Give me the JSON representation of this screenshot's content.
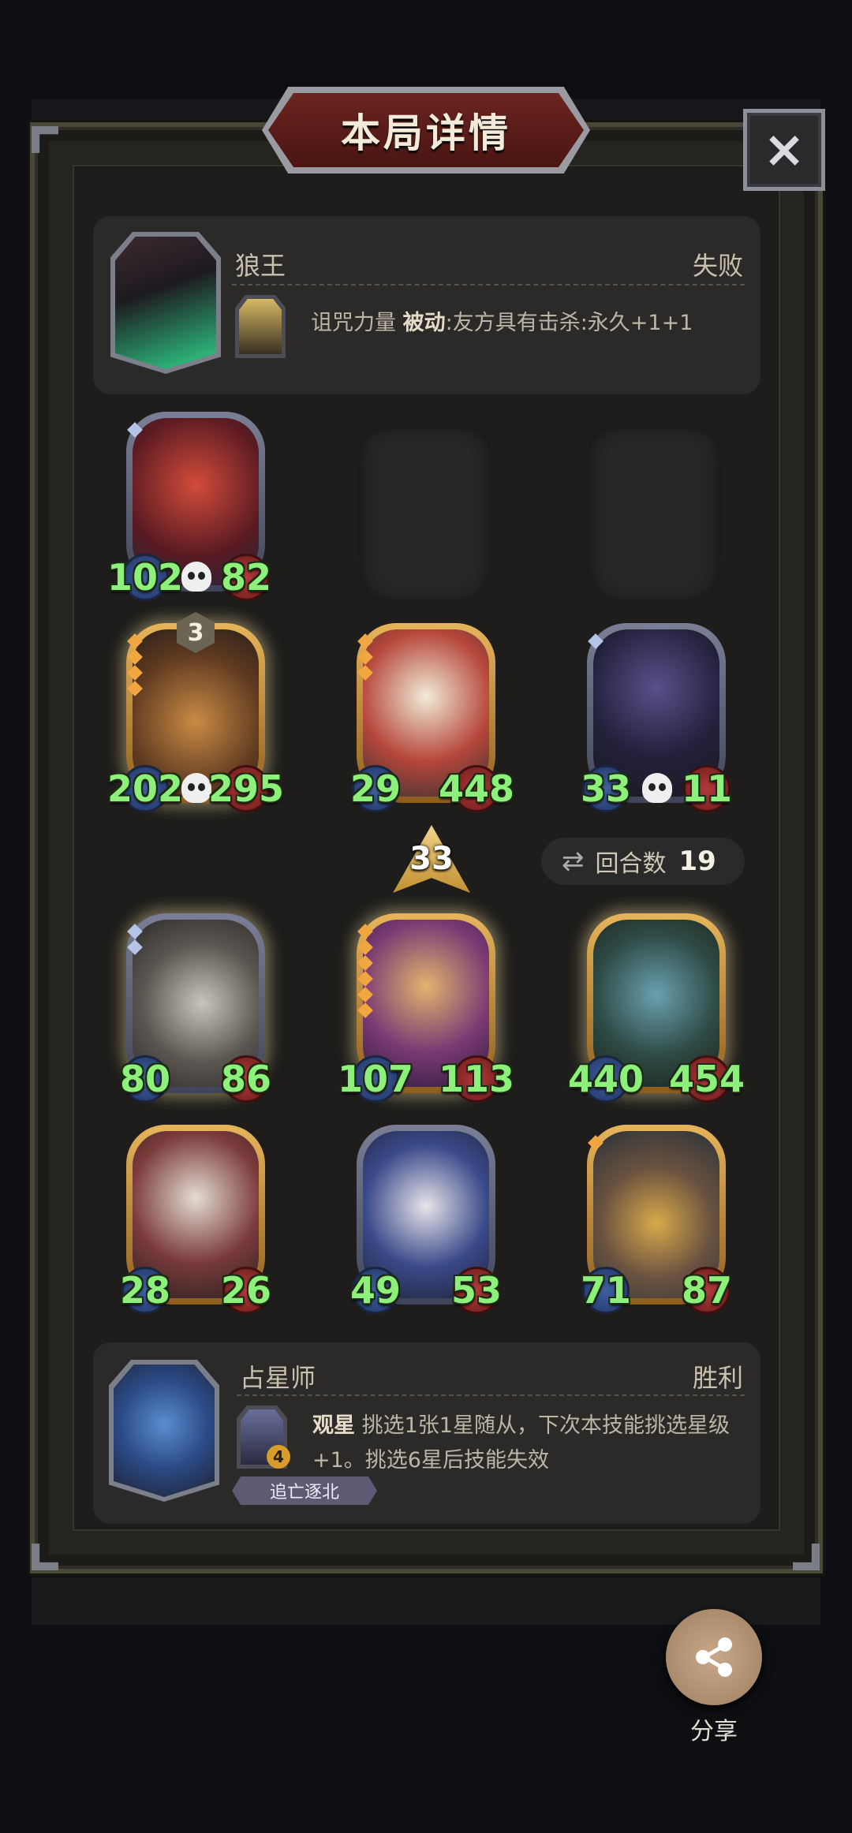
{
  "title": "本局详情",
  "close_icon": "×",
  "opponent": {
    "name": "狼王",
    "result": "失败",
    "skill_name": "诅咒力量",
    "skill_type": "被动",
    "skill_desc": ":友方具有击杀:永久+1+1"
  },
  "player": {
    "name": "占星师",
    "result": "胜利",
    "skill_name": "观星",
    "skill_desc": "挑选1张1星随从，下次本技能挑选星级+1。挑选6星后技能失效",
    "skill_level": "4",
    "tag": "追亡逐北"
  },
  "enemy_board": [
    {
      "atk": "102",
      "hp": "82"
    },
    {
      "atk": "202",
      "hp": "295",
      "level": "3"
    },
    {
      "atk": "29",
      "hp": "448"
    },
    {
      "atk": "33",
      "hp": "11"
    }
  ],
  "tier": "33",
  "round": {
    "label": "回合数",
    "value": "19"
  },
  "player_board": [
    {
      "atk": "80",
      "hp": "86"
    },
    {
      "atk": "107",
      "hp": "113"
    },
    {
      "atk": "440",
      "hp": "454"
    },
    {
      "atk": "28",
      "hp": "26"
    },
    {
      "atk": "49",
      "hp": "53"
    },
    {
      "atk": "71",
      "hp": "87"
    }
  ],
  "share_label": "分享",
  "icons": {
    "close": "close-icon",
    "round": "swap-icon",
    "share": "share-icon",
    "skull": "skull-icon"
  }
}
